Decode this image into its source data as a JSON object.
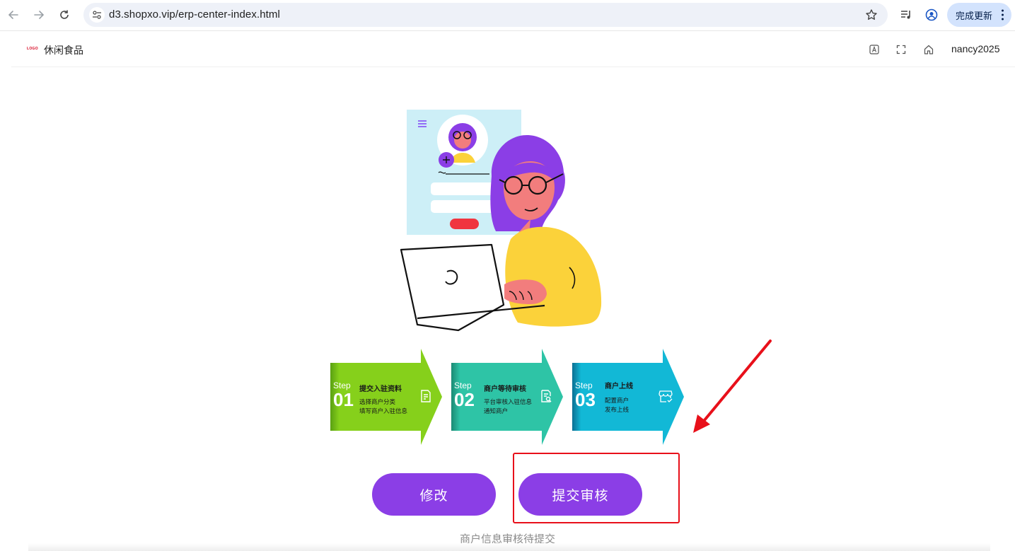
{
  "browser": {
    "url": "d3.shopxo.vip/erp-center-index.html",
    "update_label": "完成更新"
  },
  "header": {
    "logo_text": "LOGO",
    "brand": "休闲食品",
    "username": "nancy2025"
  },
  "steps": [
    {
      "step_word": "Step",
      "number": "01",
      "title": "提交入驻资料",
      "desc1": "选择商户分类",
      "desc2": "填写商户入驻信息",
      "color": "#86d01b",
      "icon": "document-edit-icon"
    },
    {
      "step_word": "Step",
      "number": "02",
      "title": "商户等待审核",
      "desc1": "平台审核入驻信息",
      "desc2": "通知商户",
      "color": "#2ec4a6",
      "icon": "document-search-icon"
    },
    {
      "step_word": "Step",
      "number": "03",
      "title": "商户上线",
      "desc1": "配置商户",
      "desc2": "发布上线",
      "color": "#12b8d6",
      "icon": "store-check-icon"
    }
  ],
  "actions": {
    "edit_label": "修改",
    "submit_label": "提交审核"
  },
  "status_text": "商户信息审核待提交",
  "colors": {
    "primary_button": "#8b3ee6",
    "annotation_red": "#e8101a"
  }
}
